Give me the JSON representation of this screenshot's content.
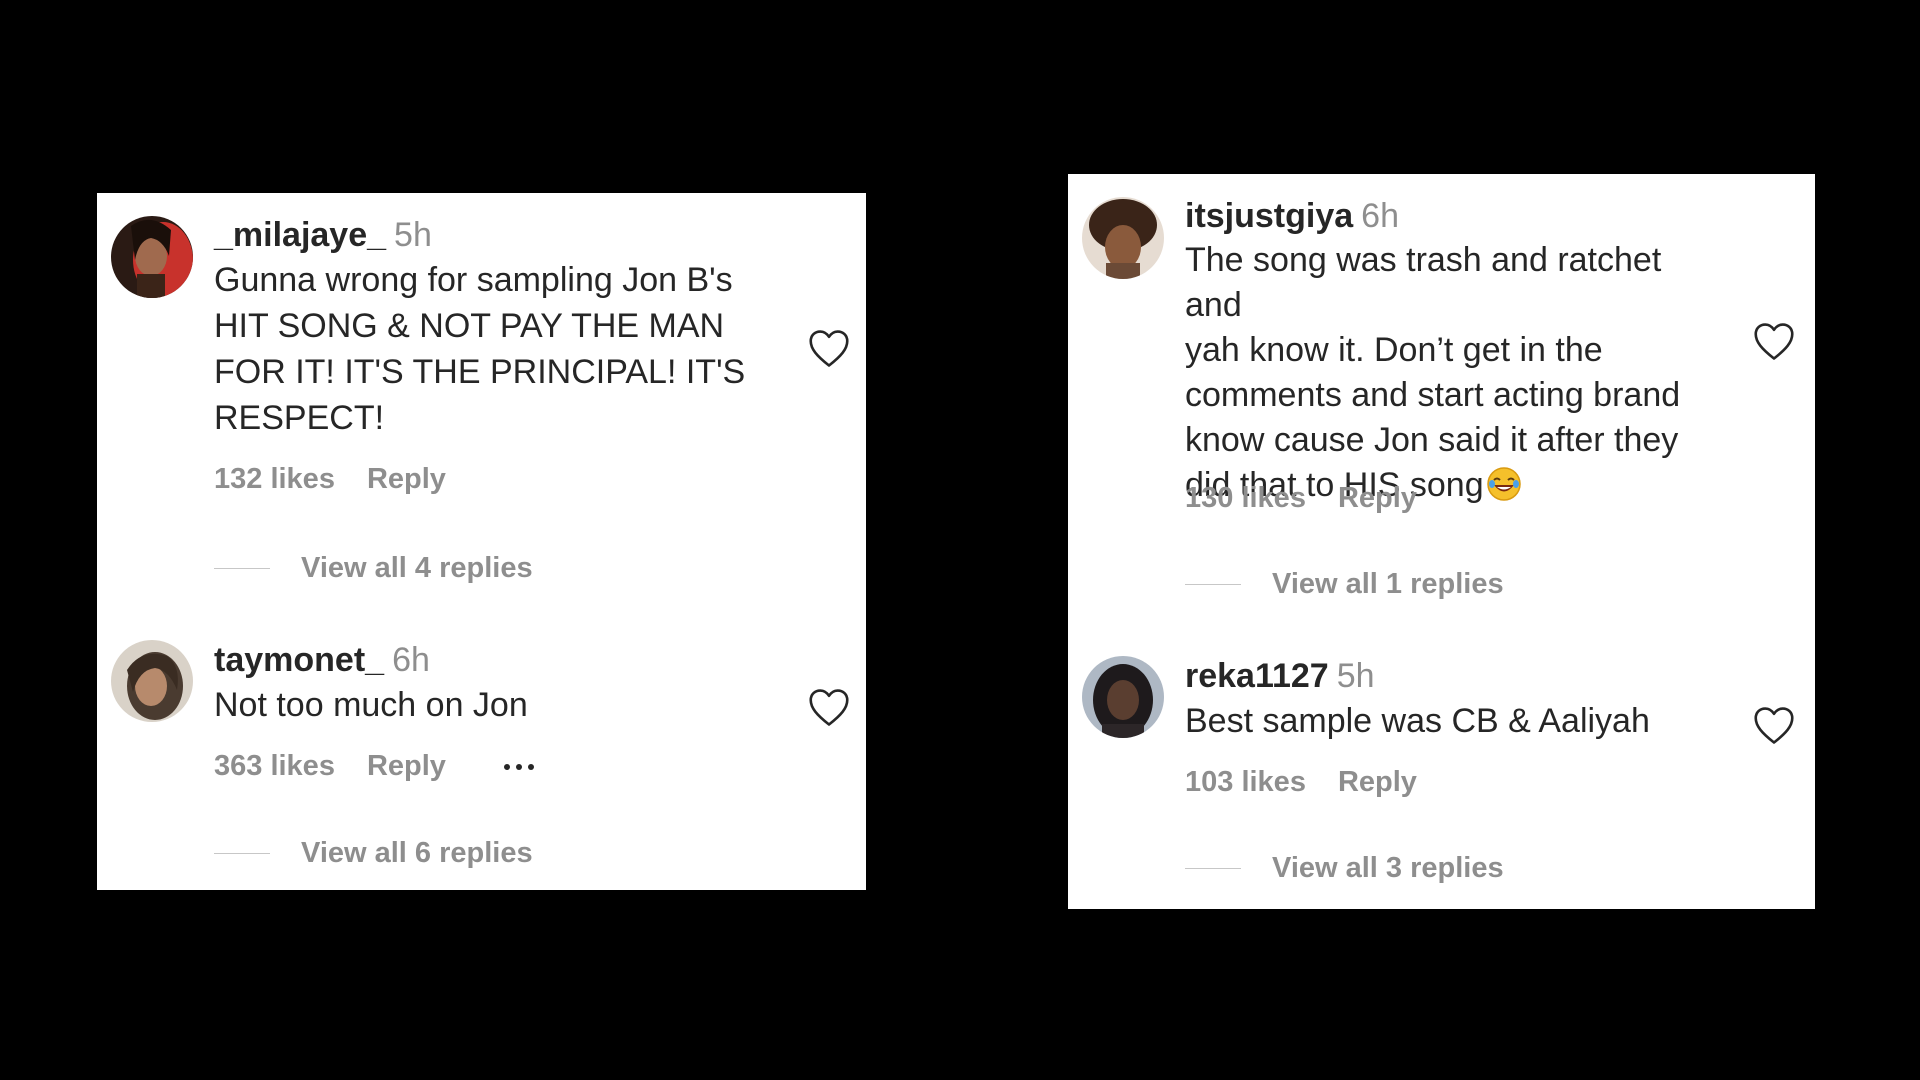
{
  "left_panel": {
    "comments": [
      {
        "username": "_milajaye_",
        "time": "5h",
        "text": "Gunna wrong for sampling Jon B's HIT SONG & NOT PAY THE MAN FOR IT! IT'S THE PRINCIPAL! IT'S RESPECT!",
        "lines": [
          "Gunna wrong for sampling Jon B's",
          "HIT SONG & NOT PAY THE MAN",
          "FOR IT! IT'S THE PRINCIPAL! IT'S",
          "RESPECT!"
        ],
        "likes": "132 likes",
        "reply": "Reply",
        "view_replies": "View all 4 replies"
      },
      {
        "username": "taymonet_",
        "time": "6h",
        "text": "Not too much on Jon",
        "likes": "363 likes",
        "reply": "Reply",
        "view_replies": "View all 6 replies"
      }
    ]
  },
  "right_panel": {
    "comments": [
      {
        "username": "itsjustgiya",
        "time": "6h",
        "lines": [
          "The song was trash and ratchet and",
          "yah know it. Don’t get in the",
          "comments and start acting brand",
          "know cause Jon said it after they",
          "did that to HIS song"
        ],
        "emoji": "face-with-tears-of-joy",
        "likes": "130 likes",
        "reply": "Reply",
        "view_replies": "View all 1 replies"
      },
      {
        "username": "reka1127",
        "time": "5h",
        "text": "Best sample was CB & Aaliyah",
        "likes": "103 likes",
        "reply": "Reply",
        "view_replies": "View all 3 replies"
      }
    ]
  },
  "icons": {
    "like": "heart-outline-icon",
    "more": "more-options-icon"
  },
  "colors": {
    "background": "#000000",
    "panel": "#ffffff",
    "text_primary": "#262626",
    "text_secondary": "#8e8e8e"
  }
}
